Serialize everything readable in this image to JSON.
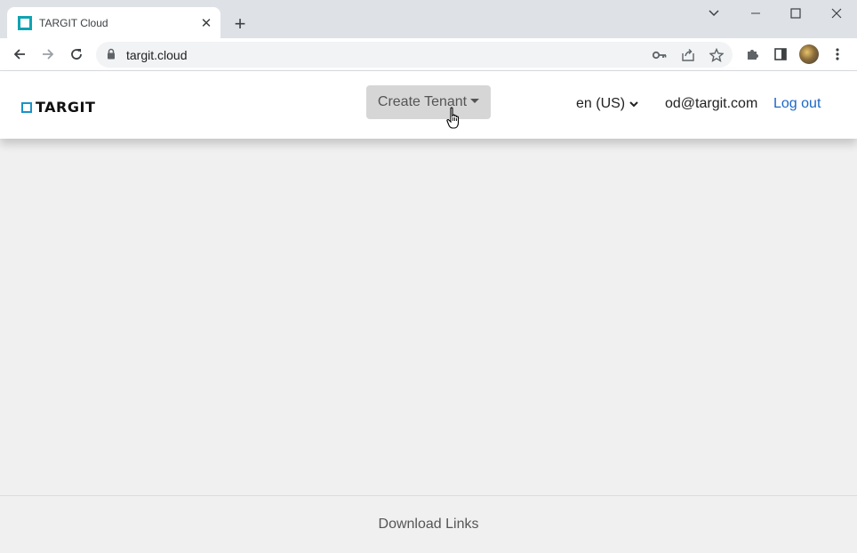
{
  "browser": {
    "tab_title": "TARGIT Cloud",
    "new_tab_label": "+",
    "url": "targit.cloud"
  },
  "navbar": {
    "logo_text": "TARGIT",
    "create_tenant_label": "Create Tenant",
    "language_label": "en (US)",
    "user_email": "od@targit.com",
    "logout_label": "Log out"
  },
  "footer": {
    "download_links_label": "Download Links"
  },
  "colors": {
    "accent_link": "#1a66c8",
    "logo_mark": "#1893c8",
    "favicon": "#0fa3b1"
  }
}
